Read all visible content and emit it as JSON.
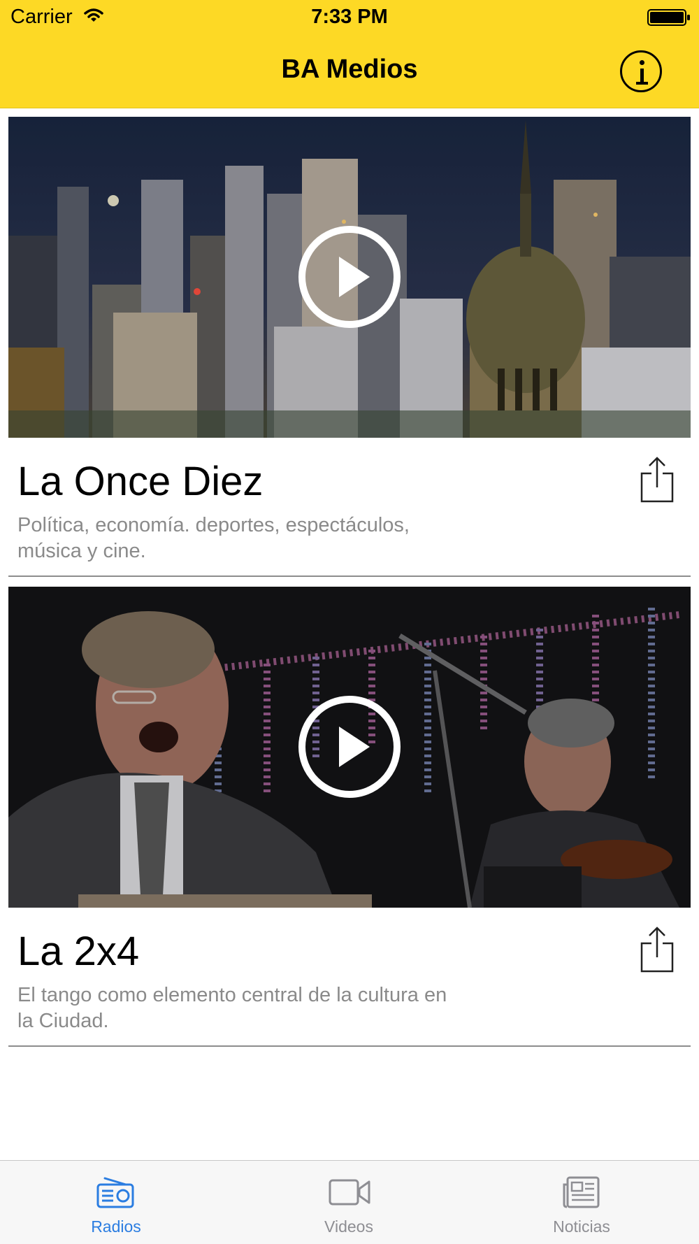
{
  "status_bar": {
    "carrier": "Carrier",
    "time": "7:33 PM"
  },
  "nav": {
    "title": "BA Medios",
    "info_icon": "info-circle-icon"
  },
  "stations": [
    {
      "title": "La Once Diez",
      "description": "Política, economía. deportes, espectáculos, música y cine.",
      "image": "buenos-aires-skyline-night",
      "play_icon": "play-icon",
      "share_icon": "share-icon"
    },
    {
      "title": "La 2x4",
      "description": "El tango como elemento central de la cultura en la Ciudad.",
      "image": "tango-orchestra-performance",
      "play_icon": "play-icon",
      "share_icon": "share-icon"
    }
  ],
  "tabs": [
    {
      "label": "Radios",
      "icon": "radio-icon",
      "active": true
    },
    {
      "label": "Videos",
      "icon": "video-camera-icon",
      "active": false
    },
    {
      "label": "Noticias",
      "icon": "newspaper-icon",
      "active": false
    }
  ],
  "colors": {
    "header_bg": "#fdd925",
    "tab_active": "#2b7de1",
    "tab_inactive": "#8e8e93",
    "description_text": "#8a8a8a"
  }
}
